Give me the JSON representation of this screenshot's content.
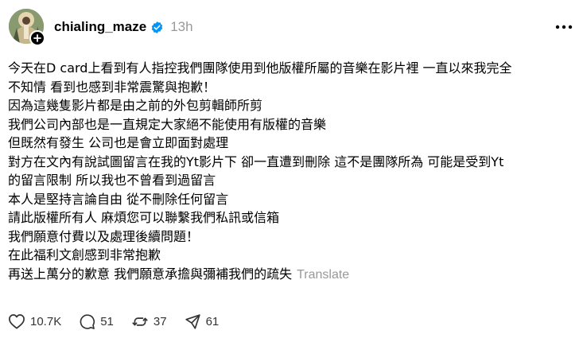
{
  "post": {
    "author": {
      "username": "chialing_maze",
      "avatar_icon": "profile-photo",
      "verified_icon": "verified-badge-icon",
      "follow_icon": "plus-icon",
      "verified_color": "#0095f6"
    },
    "time": "13h",
    "menu_icon": "more-horizontal-icon",
    "lines": [
      "今天在D card上看到有人指控我們團隊使用到他版權所屬的音樂在影片裡 一直以來我完全",
      "不知情 看到也感到非常震驚與抱歉！",
      "因為這幾隻影片都是由之前的外包剪輯師所剪",
      "我們公司內部也是一直規定大家絕不能使用有版權的音樂",
      "但既然有發生 公司也是會立即面對處理",
      "對方在文內有說試圖留言在我的Yt影片下 卻一直遭到刪除 這不是團隊所為 可能是受到Yt",
      "的留言限制 所以我也不曾看到過留言",
      "本人是堅持言論自由 從不刪除任何留言",
      "請此版權所有人 麻煩您可以聯繫我們私訊或信箱",
      "我們願意付費以及處理後續問題！",
      "在此福利文創感到非常抱歉",
      "再送上萬分的歉意 我們願意承擔與彌補我們的疏失"
    ],
    "translate_label": "Translate",
    "actions": {
      "like": {
        "icon": "heart-icon",
        "count": "10.7K"
      },
      "comment": {
        "icon": "comment-icon",
        "count": "51"
      },
      "repost": {
        "icon": "repost-icon",
        "count": "37"
      },
      "share": {
        "icon": "send-icon",
        "count": "61"
      }
    }
  }
}
